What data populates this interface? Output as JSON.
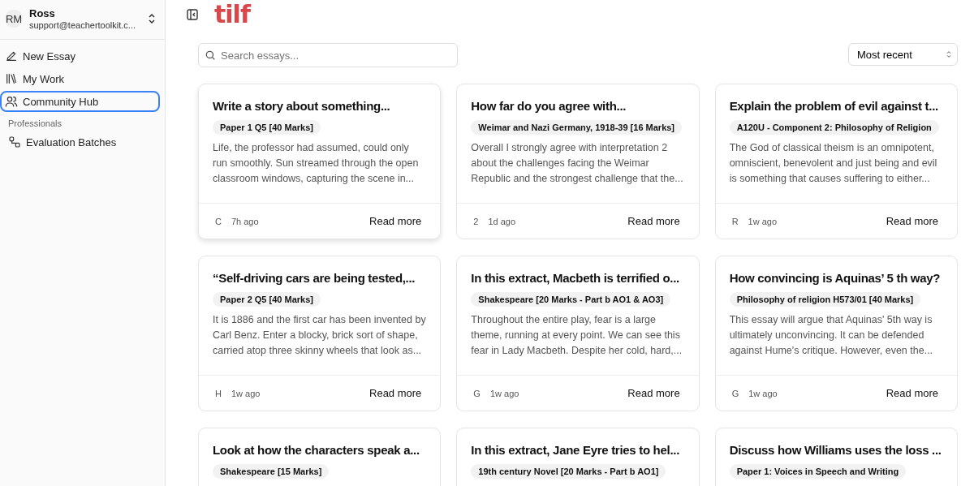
{
  "account": {
    "initials": "RM",
    "name": "Ross",
    "email": "support@teachertoolkit.c..."
  },
  "nav": [
    {
      "label": "New Essay",
      "kind": "pen",
      "selected": false
    },
    {
      "label": "My Work",
      "kind": "books",
      "selected": false
    },
    {
      "label": "Community Hub",
      "kind": "users",
      "selected": true
    }
  ],
  "section": {
    "title": "Professionals",
    "items": [
      {
        "label": "Evaluation Batches",
        "kind": "batches",
        "selected": false
      }
    ]
  },
  "header": {
    "logo": "tilf"
  },
  "search": {
    "placeholder": "Search essays..."
  },
  "sort": {
    "value": "Most recent"
  },
  "cards": [
    {
      "title": "Write a story about something...",
      "tag": "Paper 1 Q5 [40 Marks]",
      "excerpt": "Life, the professor had assumed, could only run smoothly. Sun streamed through the open classroom windows, capturing the scene in...",
      "author": "C",
      "time": "7h ago",
      "action": "Read more"
    },
    {
      "title": "How far do you agree with...",
      "tag": "Weimar and Nazi Germany, 1918-39 [16 Marks]",
      "excerpt": "Overall I strongly agree with interpretation 2 about the challenges facing the Weimar Republic and the strongest challenge that the...",
      "author": "2",
      "time": "1d ago",
      "action": "Read more"
    },
    {
      "title": "Explain the problem of evil against t...",
      "tag": "A120U - Component 2: Philosophy of Religion",
      "excerpt": "The God of classical theism is an omnipotent, omniscient, benevolent and just being and evil is something that causes suffering to either...",
      "author": "R",
      "time": "1w ago",
      "action": "Read more"
    },
    {
      "title": "“Self-driving cars are being tested,...",
      "tag": "Paper 2 Q5 [40 Marks]",
      "excerpt": "It is 1886 and the first car has been invented by Carl Benz. Enter a blocky, brick sort of shape, carried atop three skinny wheels that look as...",
      "author": "H",
      "time": "1w ago",
      "action": "Read more"
    },
    {
      "title": "In this extract, Macbeth is terrified o...",
      "tag": "Shakespeare [20 Marks - Part b AO1 & AO3]",
      "excerpt": "Throughout the entire play, fear is a large theme, running at every point. We can see this fear in Lady Macbeth. Despite her cold, hard,...",
      "author": "G",
      "time": "1w ago",
      "action": "Read more"
    },
    {
      "title": "How convincing is Aquinas’ 5 th way?",
      "tag": "Philosophy of religion H573/01 [40 Marks]",
      "excerpt": "This essay will argue that Aquinas' 5th way is ultimately unconvincing. It can be defended against Hume's critique. However, even the...",
      "author": "G",
      "time": "1w ago",
      "action": "Read more"
    },
    {
      "title": "Look at how the characters speak a...",
      "tag": "Shakespeare [15 Marks]"
    },
    {
      "title": "In this extract, Jane Eyre tries to hel...",
      "tag": "19th century Novel [20 Marks - Part b AO1]"
    },
    {
      "title": "Discuss how Williams uses the loss ...",
      "tag": "Paper 1: Voices in Speech and Writing"
    }
  ]
}
